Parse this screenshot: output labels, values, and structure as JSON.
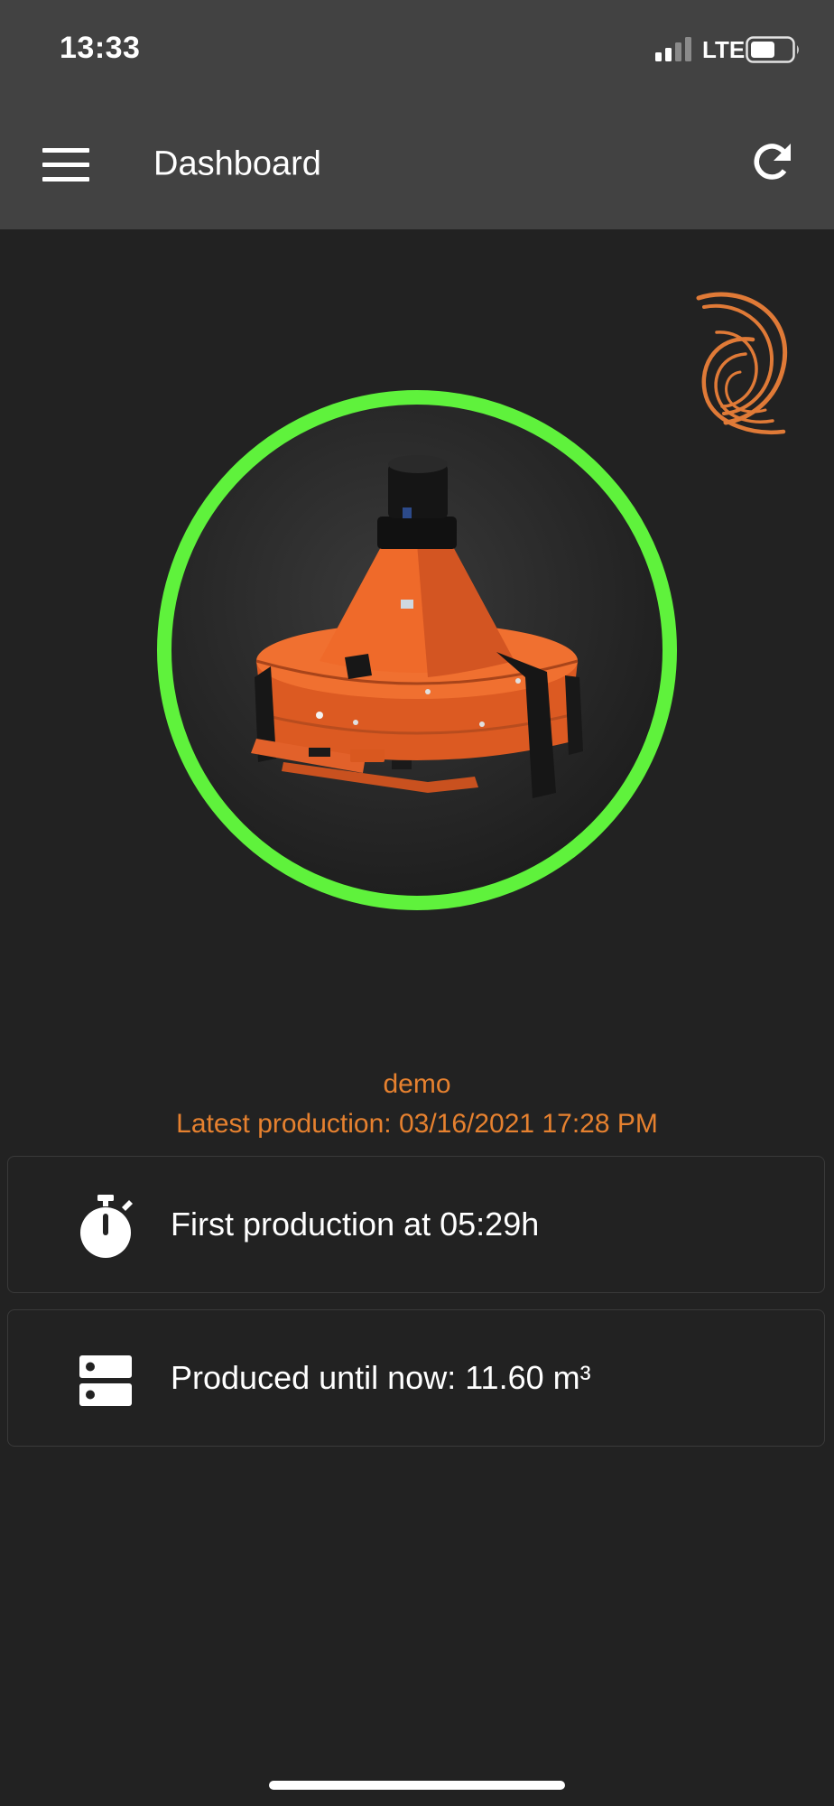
{
  "status_bar": {
    "time": "13:33",
    "network": "LTE",
    "signal_icon": "signal-strength-icon",
    "battery_icon": "battery-icon"
  },
  "app_bar": {
    "title": "Dashboard",
    "menu_icon": "hamburger-menu-icon",
    "refresh_icon": "refresh-icon"
  },
  "machine": {
    "status_color": "#5ff23c",
    "accent_color": "#ef6a2a",
    "image": "planetary-mixer-machine"
  },
  "info": {
    "device_name": "demo",
    "latest_production": "Latest production: 03/16/2021 17:28 PM"
  },
  "cards": [
    {
      "icon": "stopwatch-icon",
      "text": "First production at 05:29h"
    },
    {
      "icon": "server-icon",
      "text": "Produced until now: 11.60 m³"
    }
  ],
  "colors": {
    "background": "#222222",
    "bar": "#424242",
    "accent_text": "#e6812f"
  }
}
